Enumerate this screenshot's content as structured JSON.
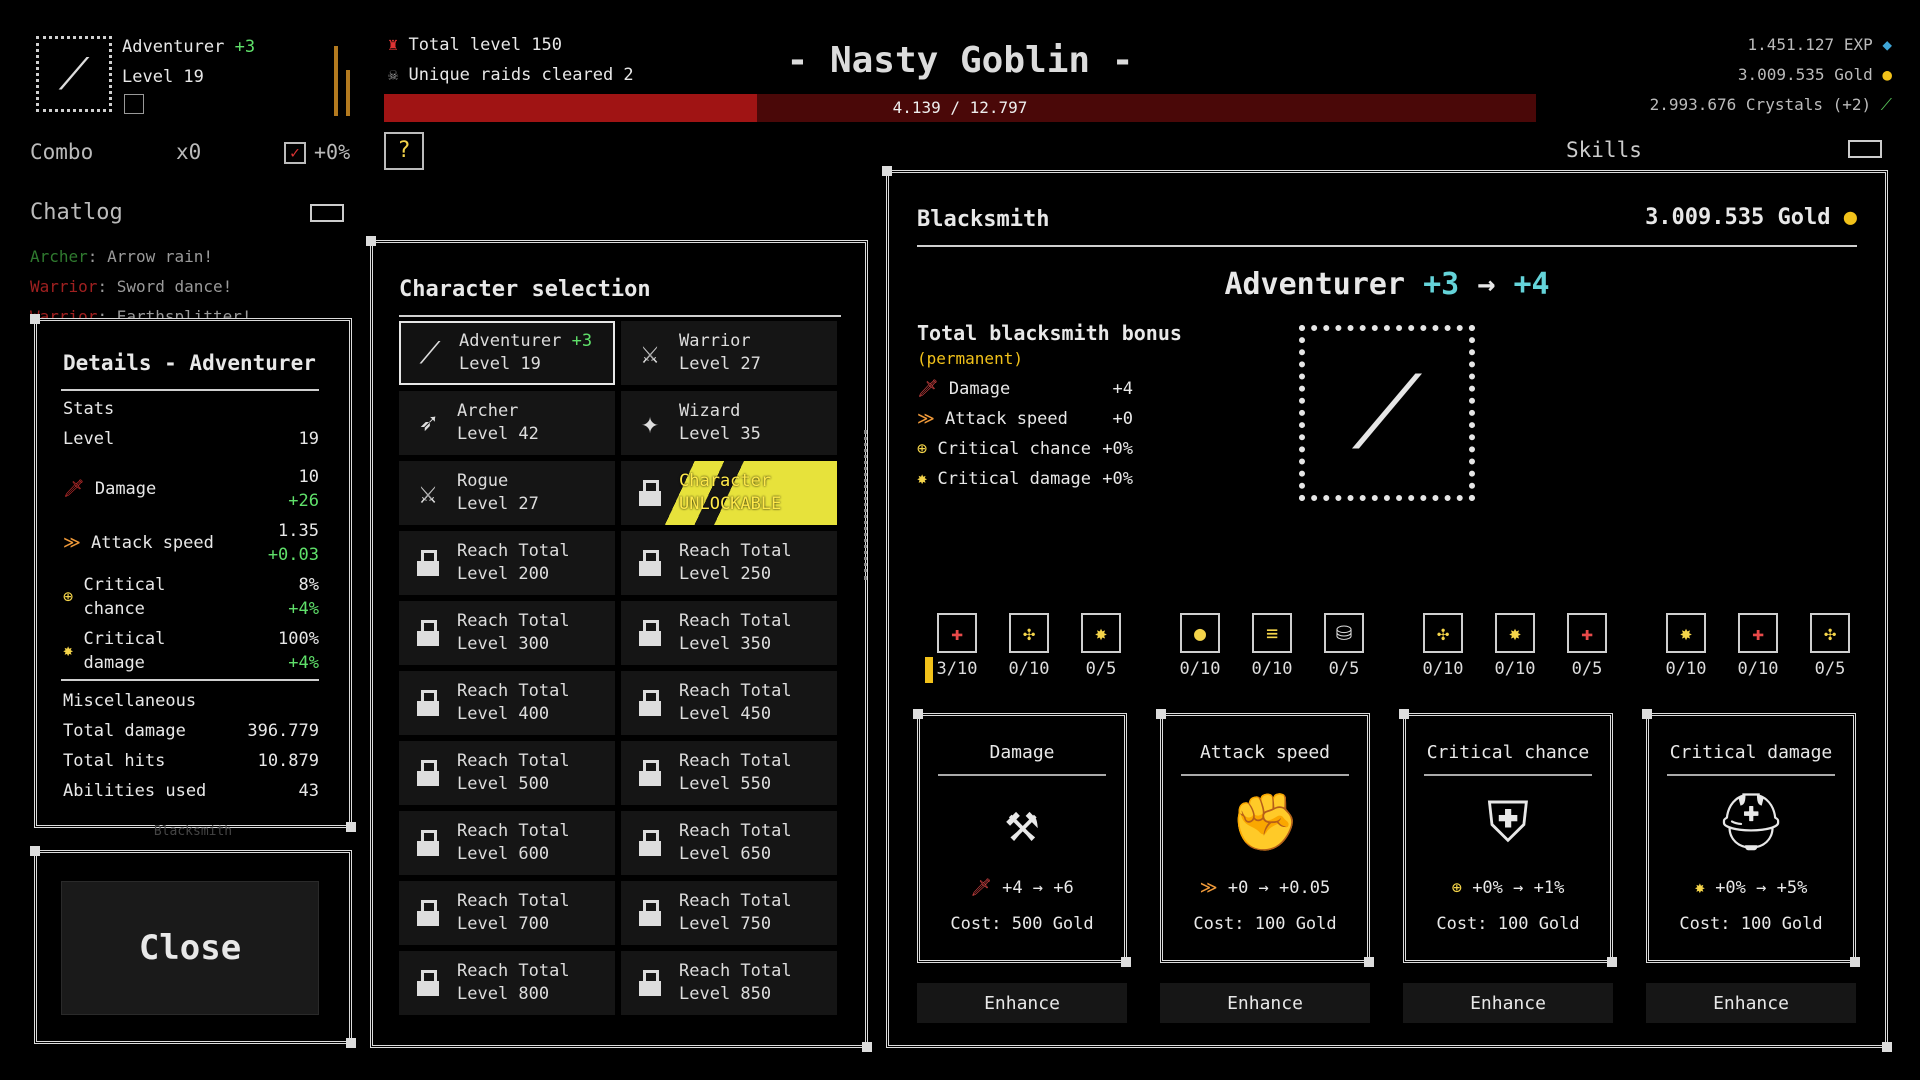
{
  "player": {
    "class_name": "Adventurer",
    "class_bonus": "+3",
    "level": "Level 19"
  },
  "stats_top": {
    "total_level": "Total level 150",
    "unique_raids": "Unique raids cleared 2"
  },
  "enemy": {
    "name": "- Nasty Goblin -",
    "hp_text": "4.139 / 12.797",
    "hp_fraction": 0.3234
  },
  "resources": {
    "exp": "1.451.127 EXP",
    "gold": "3.009.535 Gold",
    "crystals": "2.993.676 Crystals (+2)"
  },
  "combo": {
    "label": "Combo",
    "value": "x0",
    "bonus": "+0%"
  },
  "skills_label": "Skills",
  "chatlog": {
    "title": "Chatlog",
    "messages": [
      {
        "who": "Archer",
        "text": ": Arrow rain!"
      },
      {
        "who": "Warrior",
        "text": ": Sword dance!"
      },
      {
        "who": "Warrior",
        "text": ": Earthsplitter!"
      }
    ]
  },
  "details": {
    "title": "Details - Adventurer",
    "stats_header": "Stats",
    "level_label": "Level",
    "level_value": "19",
    "damage_label": "Damage",
    "damage_value": "10",
    "damage_bonus": "+26",
    "atk_label": "Attack speed",
    "atk_value": "1.35",
    "atk_bonus": "+0.03",
    "crit_label_1": "Critical",
    "crit_label_2": "chance",
    "crit_value": "8%",
    "crit_bonus": "+4%",
    "critd_label_1": "Critical",
    "critd_label_2": "damage",
    "critd_value": "100%",
    "critd_bonus": "+4%",
    "misc_header": "Miscellaneous",
    "total_damage_label": "Total damage",
    "total_damage_value": "396.779",
    "total_hits_label": "Total hits",
    "total_hits_value": "10.879",
    "abilities_label": "Abilities used",
    "abilities_value": "43",
    "under_label": "Blacksmith"
  },
  "close_button": "Close",
  "character_selection": {
    "title": "Character selection",
    "cards": [
      {
        "name": "Adventurer",
        "bonus": "+3",
        "level": "Level 19",
        "icon": "sword-icon",
        "glyph": "⟋",
        "state": "selected"
      },
      {
        "name": "Warrior",
        "bonus": "",
        "level": "Level 27",
        "icon": "broadsword-icon",
        "glyph": "⚔",
        "state": "normal"
      },
      {
        "name": "Archer",
        "bonus": "",
        "level": "Level 42",
        "icon": "bow-icon",
        "glyph": "➶",
        "state": "normal"
      },
      {
        "name": "Wizard",
        "bonus": "",
        "level": "Level 35",
        "icon": "staff-icon",
        "glyph": "✦",
        "state": "normal"
      },
      {
        "name": "Rogue",
        "bonus": "",
        "level": "Level 27",
        "icon": "daggers-icon",
        "glyph": "⚔",
        "state": "normal"
      },
      {
        "name": "Character",
        "bonus": "",
        "level": "UNLOCKABLE",
        "icon": "lock-icon",
        "glyph": "",
        "state": "unlock"
      },
      {
        "name": "Reach Total",
        "bonus": "",
        "level": "Level 200",
        "icon": "lock-icon",
        "glyph": "",
        "state": "locked"
      },
      {
        "name": "Reach Total",
        "bonus": "",
        "level": "Level 250",
        "icon": "lock-icon",
        "glyph": "",
        "state": "locked"
      },
      {
        "name": "Reach Total",
        "bonus": "",
        "level": "Level 300",
        "icon": "lock-icon",
        "glyph": "",
        "state": "locked"
      },
      {
        "name": "Reach Total",
        "bonus": "",
        "level": "Level 350",
        "icon": "lock-icon",
        "glyph": "",
        "state": "locked"
      },
      {
        "name": "Reach Total",
        "bonus": "",
        "level": "Level 400",
        "icon": "lock-icon",
        "glyph": "",
        "state": "locked"
      },
      {
        "name": "Reach Total",
        "bonus": "",
        "level": "Level 450",
        "icon": "lock-icon",
        "glyph": "",
        "state": "locked"
      },
      {
        "name": "Reach Total",
        "bonus": "",
        "level": "Level 500",
        "icon": "lock-icon",
        "glyph": "",
        "state": "locked"
      },
      {
        "name": "Reach Total",
        "bonus": "",
        "level": "Level 550",
        "icon": "lock-icon",
        "glyph": "",
        "state": "locked"
      },
      {
        "name": "Reach Total",
        "bonus": "",
        "level": "Level 600",
        "icon": "lock-icon",
        "glyph": "",
        "state": "locked"
      },
      {
        "name": "Reach Total",
        "bonus": "",
        "level": "Level 650",
        "icon": "lock-icon",
        "glyph": "",
        "state": "locked"
      },
      {
        "name": "Reach Total",
        "bonus": "",
        "level": "Level 700",
        "icon": "lock-icon",
        "glyph": "",
        "state": "locked"
      },
      {
        "name": "Reach Total",
        "bonus": "",
        "level": "Level 750",
        "icon": "lock-icon",
        "glyph": "",
        "state": "locked"
      },
      {
        "name": "Reach Total",
        "bonus": "",
        "level": "Level 800",
        "icon": "lock-icon",
        "glyph": "",
        "state": "locked"
      },
      {
        "name": "Reach Total",
        "bonus": "",
        "level": "Level 850",
        "icon": "lock-icon",
        "glyph": "",
        "state": "locked"
      }
    ]
  },
  "blacksmith": {
    "title": "Blacksmith",
    "gold": "3.009.535 Gold",
    "upgrade_class": "Adventurer",
    "upgrade_from": "+3",
    "upgrade_arrow": "→",
    "upgrade_to": "+4",
    "bonus_title": "Total blacksmith bonus",
    "bonus_sub": "(permanent)",
    "bonuses": [
      {
        "label": "Damage",
        "value": "+4",
        "icon": "sword-red-icon",
        "glyph": "🗡",
        "color": "#e84a4a"
      },
      {
        "label": "Attack speed",
        "value": "+0",
        "icon": "speed-icon",
        "glyph": "≫",
        "color": "#f09a3a"
      },
      {
        "label": "Critical chance",
        "value": "+0%",
        "icon": "crosshair-icon",
        "glyph": "⊕",
        "color": "#f4d44a"
      },
      {
        "label": "Critical damage",
        "value": "+0%",
        "icon": "burst-icon",
        "glyph": "✸",
        "color": "#f4d44a"
      }
    ],
    "slots": [
      {
        "label": "3/10",
        "glyph": "✚",
        "color": "#e84a4a",
        "progress": 0.3
      },
      {
        "label": "0/10",
        "glyph": "✣",
        "color": "#f4d44a",
        "progress": 0
      },
      {
        "label": "0/5",
        "glyph": "✸",
        "color": "#f4d44a",
        "progress": 0
      },
      {
        "label": "0/10",
        "glyph": "●",
        "color": "#f4d44a",
        "progress": 0
      },
      {
        "label": "0/10",
        "glyph": "≡",
        "color": "#f4d44a",
        "progress": 0
      },
      {
        "label": "0/5",
        "glyph": "⛁",
        "color": "#dddddd",
        "progress": 0
      },
      {
        "label": "0/10",
        "glyph": "✣",
        "color": "#f4d44a",
        "progress": 0
      },
      {
        "label": "0/10",
        "glyph": "✸",
        "color": "#f4d44a",
        "progress": 0
      },
      {
        "label": "0/5",
        "glyph": "✚",
        "color": "#e84a4a",
        "progress": 0
      },
      {
        "label": "0/10",
        "glyph": "✸",
        "color": "#f4d44a",
        "progress": 0
      },
      {
        "label": "0/10",
        "glyph": "✚",
        "color": "#e84a4a",
        "progress": 0
      },
      {
        "label": "0/5",
        "glyph": "✣",
        "color": "#f4d44a",
        "progress": 0
      }
    ],
    "upgrades": [
      {
        "title": "Damage",
        "icon": "anvil-icon",
        "glyph": "⚒",
        "value": "+4 → +6",
        "val_glyph": "🗡",
        "val_color": "#e84a4a",
        "cost": "Cost: 500 Gold",
        "button": "Enhance"
      },
      {
        "title": "Attack speed",
        "icon": "gauntlet-icon",
        "glyph": "✊",
        "value": "+0 → +0.05",
        "val_glyph": "≫",
        "val_color": "#f09a3a",
        "cost": "Cost: 100 Gold",
        "button": "Enhance"
      },
      {
        "title": "Critical chance",
        "icon": "armor-icon",
        "glyph": "⛨",
        "value": "+0% → +1%",
        "val_glyph": "⊕",
        "val_color": "#f4d44a",
        "cost": "Cost: 100 Gold",
        "button": "Enhance"
      },
      {
        "title": "Critical damage",
        "icon": "helmet-icon",
        "glyph": "⛑",
        "value": "+0% → +5%",
        "val_glyph": "✸",
        "val_color": "#f4d44a",
        "cost": "Cost: 100 Gold",
        "button": "Enhance"
      }
    ]
  },
  "colors": {
    "hp_fill": "#a01414",
    "hp_track": "#4a0808",
    "gold_coin": "#f2c21a",
    "exp_gem": "#3fa6d8",
    "crystal": "#58c85a",
    "accent_green": "#5fe06a",
    "accent_cyan": "#64d3d9",
    "unlock_yellow": "#e7e23b"
  }
}
